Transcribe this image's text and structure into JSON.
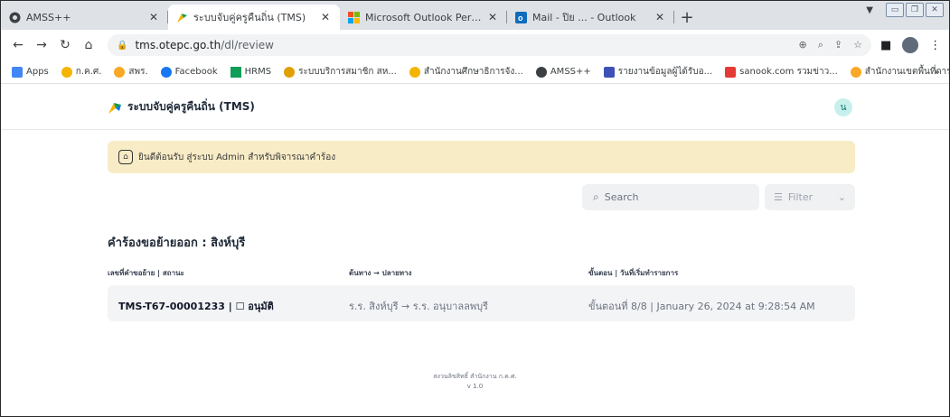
{
  "tabs": [
    {
      "label": "AMSS++",
      "icon": "amss-icon",
      "active": false
    },
    {
      "label": "ระบบจับคู่ครูคืนถิ่น (TMS)",
      "icon": "tms-logo-icon",
      "active": true
    },
    {
      "label": "Microsoft Outlook Personal Email",
      "icon": "microsoft-icon",
      "active": false
    },
    {
      "label": "Mail - ปิย ... - Outlook",
      "icon": "outlook-icon",
      "active": false
    }
  ],
  "address": {
    "host": "tms.otepc.go.th",
    "path": "/dl/review"
  },
  "bookmarks": [
    {
      "label": "Apps",
      "color": "#4285f4"
    },
    {
      "label": "ก.ค.ศ.",
      "color": "#f4b400"
    },
    {
      "label": "สพร.",
      "color": "#f9a825"
    },
    {
      "label": "Facebook",
      "color": "#1877f2"
    },
    {
      "label": "HRMS",
      "color": "#0f9d58"
    },
    {
      "label": "ระบบบริการสมาชิก สห...",
      "color": "#e0a000"
    },
    {
      "label": "สำนักงานศึกษาธิการจัง...",
      "color": "#f4b400"
    },
    {
      "label": "AMSS++",
      "color": "#3c4043"
    },
    {
      "label": "รายงานข้อมูลผู้ได้รับอ...",
      "color": "#3f51b5"
    },
    {
      "label": "sanook.com รวมข่าว...",
      "color": "#e53935"
    },
    {
      "label": "สำนักงานเขตพื้นที่การ...",
      "color": "#f9a825"
    }
  ],
  "bookmarks_more": "»",
  "app": {
    "title": "ระบบจับคู่ครูคืนถิ่น (TMS)",
    "avatar_initial": "น"
  },
  "alert": {
    "text": "ยินดีต้อนรับ สู่ระบบ Admin สำหรับพิจารณาคำร้อง"
  },
  "search": {
    "placeholder": "Search"
  },
  "filter": {
    "label": "Filter"
  },
  "section": {
    "title": "คำร้องขอย้ายออก : สิงห์บุรี"
  },
  "table": {
    "headers": [
      "เลขที่คำขอย้าย | สถานะ",
      "ต้นทาง → ปลายทาง",
      "ขั้นตอน | วันที่เริ่มทำรายการ"
    ],
    "rows": [
      {
        "id": "TMS-T67-00001233 | ☐ อนุมัติ",
        "route": "ร.ร. สิงห์บุรี → ร.ร. อนุบาลลพบุรี",
        "step": "ขั้นตอนที่ 8/8 | January 26, 2024 at 9:28:54 AM"
      }
    ]
  },
  "footer": {
    "line1": "สงวนลิขสิทธิ์ สำนักงาน ก.ค.ศ.",
    "line2": "v 1.0"
  }
}
